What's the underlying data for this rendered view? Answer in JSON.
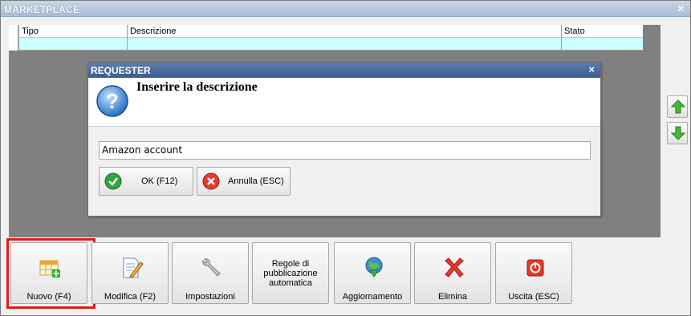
{
  "window": {
    "title": "MARKETPLACE",
    "close_glyph": "×"
  },
  "grid": {
    "columns": [
      "Tipo",
      "Descrizione",
      "Stato"
    ]
  },
  "side_buttons": {
    "up_icon": "arrow-up-icon",
    "down_icon": "arrow-down-icon",
    "color": "#3aa832"
  },
  "dialog": {
    "title": "REQUESTER",
    "close_glyph": "×",
    "message": "Inserire la descrizione",
    "input_value": "Amazon account",
    "ok_label": "OK (F12)",
    "cancel_label": "Annulla (ESC)"
  },
  "toolbar": {
    "new_label": "Nuovo (F4)",
    "edit_label": "Modifica (F2)",
    "settings_label": "Impostazioni",
    "rules_label": "Regole di pubblicazione automatica",
    "update_label": "Aggiornamento",
    "delete_label": "Elimina",
    "exit_label": "Uscita (ESC)"
  },
  "colors": {
    "highlight": "#e01b1b",
    "row_selected": "#ccffff",
    "dialog_title": "#3a5b90"
  }
}
